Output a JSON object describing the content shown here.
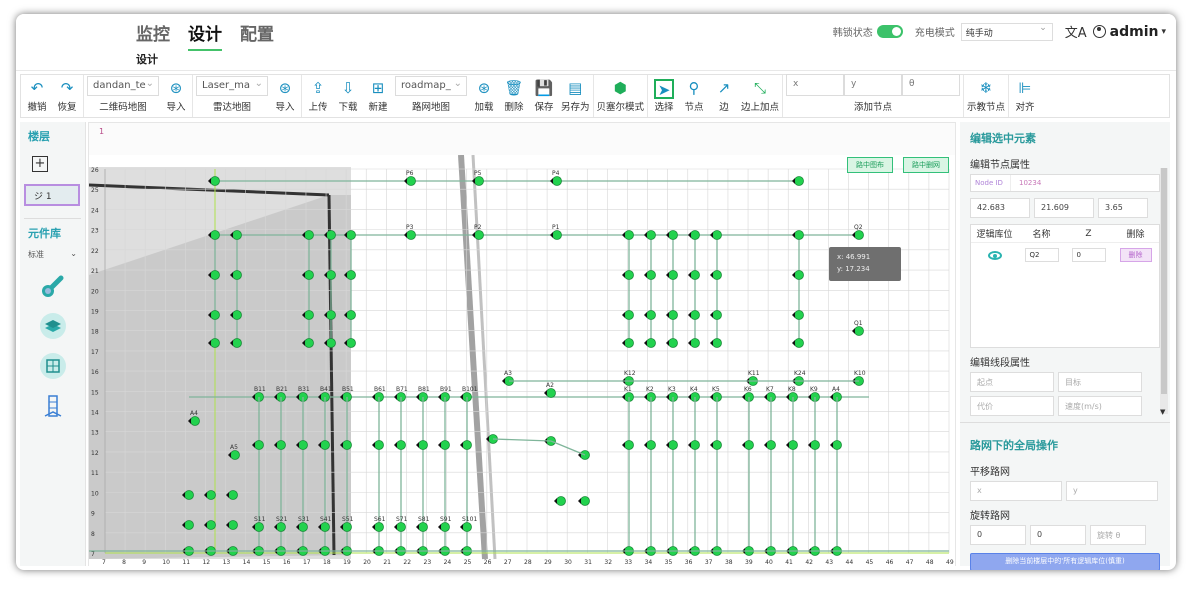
{
  "header": {
    "tabs": [
      "监控",
      "设计",
      "配置"
    ],
    "active_tab": "设计",
    "subtab": "设计",
    "lock_status_label": "韩锁状态",
    "charge_mode_label": "充电模式",
    "charge_mode_value": "纯手动",
    "user": "admin"
  },
  "toolbar": {
    "undo": "撤销",
    "redo": "恢复",
    "qr_map_value": "dandan_te",
    "qr_map_label": "二维码地图",
    "import1": "导入",
    "laser_map_value": "Laser_ma",
    "laser_map_label": "雷达地图",
    "import2": "导入",
    "upload": "上传",
    "download": "下载",
    "new": "新建",
    "road_map_value": "roadmap_",
    "road_map_label": "路网地图",
    "load": "加载",
    "delete": "删除",
    "save": "保存",
    "save_as": "另存为",
    "bezier": "贝塞尔模式",
    "select": "选择",
    "node": "节点",
    "edge": "边",
    "edge_add_node": "边上加点",
    "add_x": "x",
    "add_y": "y",
    "add_theta": "θ",
    "add_node_label": "添加节点",
    "show_nodes": "示教节点",
    "align": "对齐"
  },
  "left_panel": {
    "floor_title": "楼层",
    "floor_item": "ジ 1",
    "components_title": "元件库",
    "standard": "标准"
  },
  "map": {
    "tab_label": "1",
    "btn_path_display": "路中图布",
    "btn_path_delete": "路中删网",
    "coord_x": "x: 46.991",
    "coord_y": "y: 17.234",
    "row_labels": [
      "26",
      "25",
      "24",
      "23",
      "22",
      "21",
      "20",
      "19",
      "18",
      "17",
      "16",
      "15",
      "14",
      "13",
      "12",
      "11",
      "10",
      "9",
      "8",
      "7"
    ],
    "col_labels": [
      "7",
      "8",
      "9",
      "10",
      "11",
      "12",
      "13",
      "14",
      "15",
      "16",
      "17",
      "18",
      "19",
      "20",
      "21",
      "22",
      "23",
      "24",
      "25",
      "26",
      "27",
      "28",
      "29",
      "30",
      "31",
      "32",
      "33",
      "34",
      "35",
      "36",
      "37",
      "38",
      "39",
      "40",
      "41",
      "42",
      "43",
      "44",
      "45",
      "46",
      "47",
      "48",
      "49"
    ],
    "node_labels_top": [
      "P6",
      "P5",
      "P4",
      "P3",
      "P2",
      "P1",
      "Q2",
      "Q1"
    ],
    "node_labels_mid": [
      "A3",
      "A2",
      "K12",
      "K11",
      "K24",
      "K10",
      "B11",
      "B21",
      "B31",
      "B41",
      "B51",
      "B61",
      "B71",
      "B81",
      "B91",
      "B101",
      "K1",
      "K2",
      "K3",
      "K4",
      "K5",
      "K6",
      "K7",
      "K8",
      "K9",
      "A4",
      "A5"
    ],
    "node_labels_bottom": [
      "S11",
      "S21",
      "S31",
      "S41",
      "S51",
      "S61",
      "S71",
      "S81",
      "S91",
      "S101"
    ]
  },
  "right_panel": {
    "edit_title": "编辑选中元素",
    "node_props": "编辑节点属性",
    "node_id_label": "Node ID",
    "node_id_value": "10234",
    "pos_x": "42.683",
    "pos_y": "21.609",
    "pos_theta": "3.65",
    "lc_col1": "逻辑库位",
    "lc_col2": "名称",
    "lc_col3": "Z",
    "lc_col4": "删除",
    "lc_name": "Q2",
    "lc_z": "0",
    "lc_delete": "删除",
    "edge_props": "编辑线段属性",
    "edge_start": "起点",
    "edge_target": "目标",
    "edge_cost": "代价",
    "edge_speed": "速度(m/s)",
    "global_title": "路网下的全局操作",
    "translate_label": "平移路网",
    "translate_x": "x",
    "translate_y": "y",
    "rotate_label": "旋转路网",
    "rotate_x": "0",
    "rotate_y": "0",
    "rotate_theta": "旋转 θ",
    "delete_all": "删除当前楼层中的'所有逻辑库位(慎重)"
  },
  "colors": {
    "accent_green": "#1fae5a",
    "node_green": "#22d24e",
    "toolbar_blue": "#1a8fbf",
    "panel_title": "#2a9a9c"
  }
}
